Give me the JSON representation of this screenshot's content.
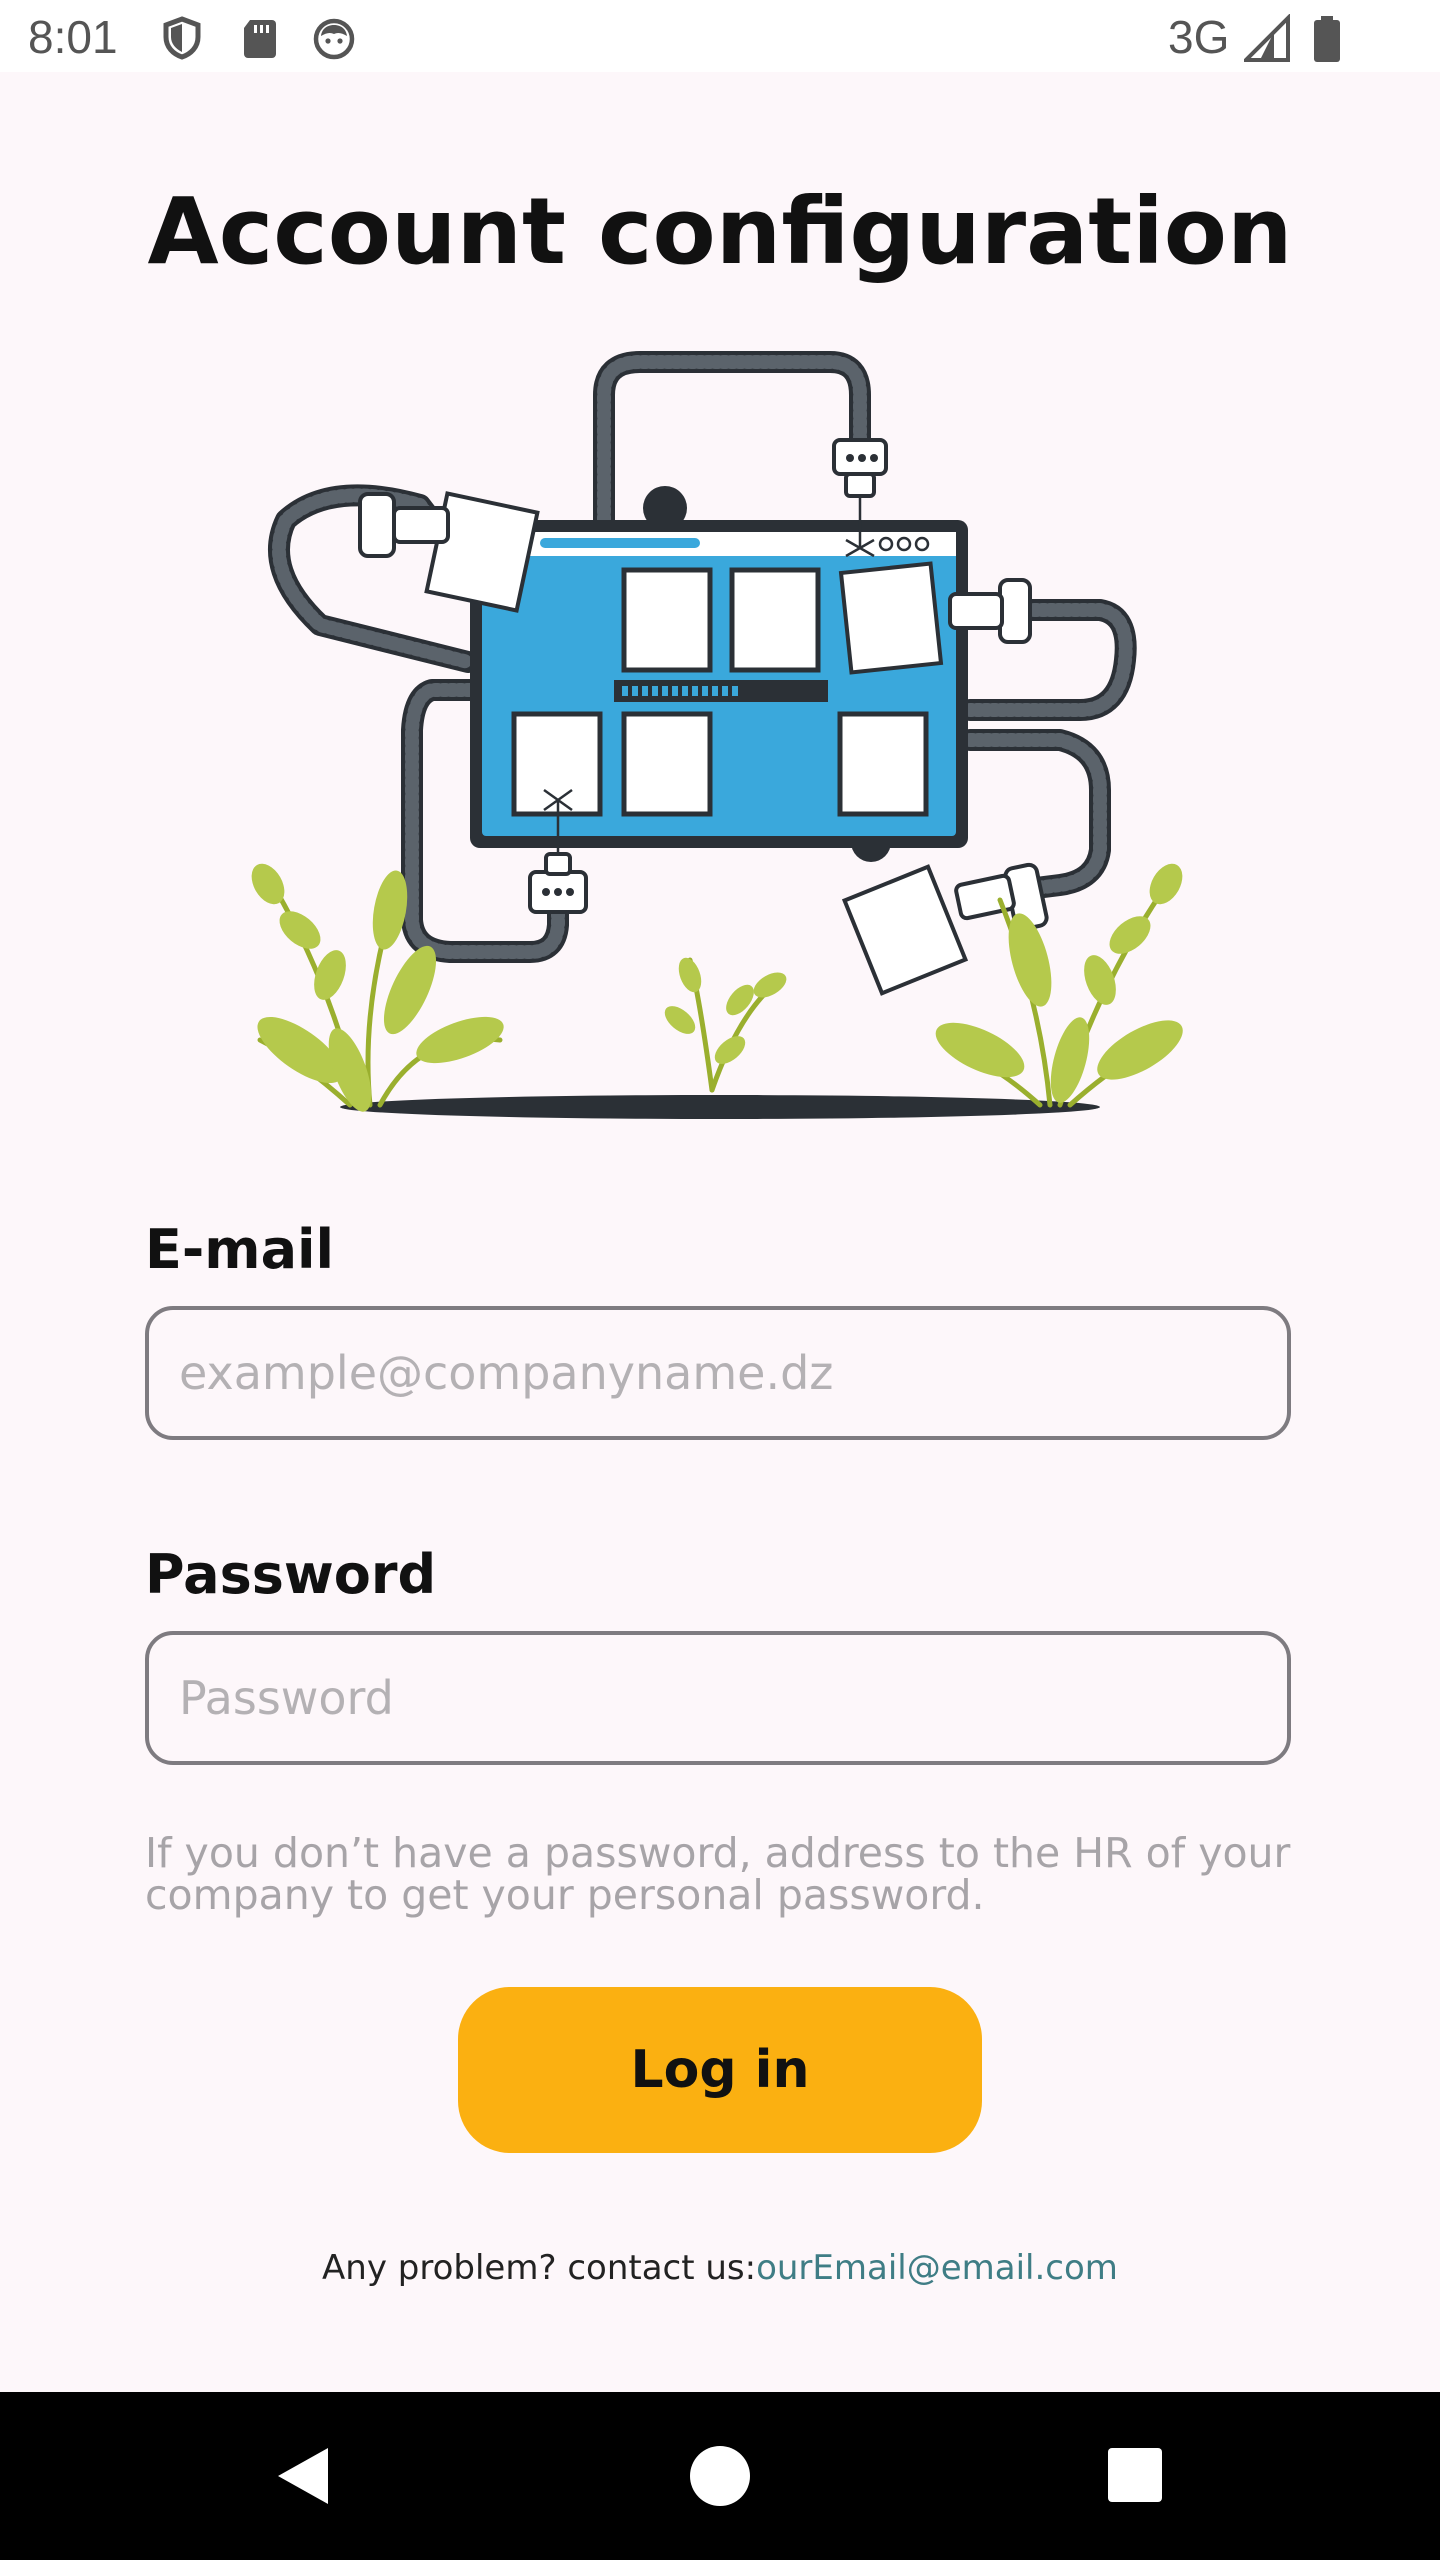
{
  "status_bar": {
    "time": "8:01",
    "network": "3G",
    "icons": [
      "shield-icon",
      "sd-card-icon",
      "cat-face-icon",
      "signal-icon",
      "battery-icon"
    ]
  },
  "page": {
    "title": "Account configuration",
    "illustration": "configuration-machine-illustration"
  },
  "form": {
    "email_label": "E-mail",
    "email_placeholder": "example@companyname.dz",
    "email_value": "",
    "password_label": "Password",
    "password_placeholder": "Password",
    "password_value": "",
    "hint": "If you don’t have a password, address to the HR of your company to get your personal password.",
    "login_label": "Log in"
  },
  "contact": {
    "prefix": "Any problem?  contact us:",
    "email": "ourEmail@email.com"
  },
  "nav_bar": {
    "buttons": [
      "back-icon",
      "home-icon",
      "recents-icon"
    ]
  },
  "colors": {
    "background": "#fdf7fa",
    "accent": "#fbb011",
    "link": "#3f7d85",
    "machine_blue": "#3aa8dc",
    "leaf_green": "#b5c94c",
    "dark": "#2b3036"
  }
}
